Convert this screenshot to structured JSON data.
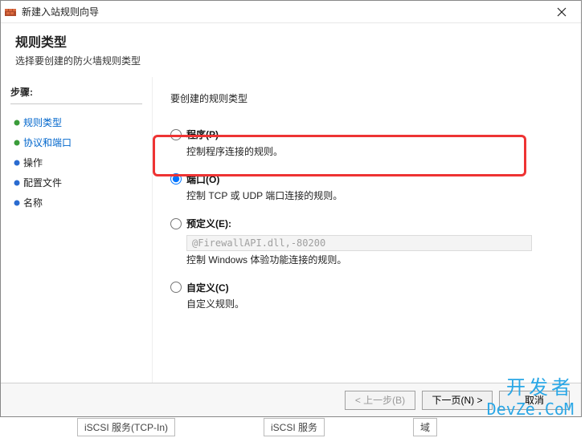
{
  "window": {
    "title": "新建入站规则向导"
  },
  "header": {
    "title": "规则类型",
    "subtitle": "选择要创建的防火墙规则类型"
  },
  "sidebar": {
    "title": "步骤:",
    "items": [
      {
        "label": "规则类型",
        "link": true,
        "bullet": "green"
      },
      {
        "label": "协议和端口",
        "link": true,
        "bullet": "green"
      },
      {
        "label": "操作",
        "link": false,
        "bullet": "blue"
      },
      {
        "label": "配置文件",
        "link": false,
        "bullet": "blue"
      },
      {
        "label": "名称",
        "link": false,
        "bullet": "blue"
      }
    ]
  },
  "main": {
    "prompt": "要创建的规则类型",
    "options": {
      "program": {
        "label": "程序(P)",
        "desc": "控制程序连接的规则。"
      },
      "port": {
        "label": "端口(O)",
        "desc": "控制 TCP 或 UDP 端口连接的规则。"
      },
      "predef": {
        "label": "预定义(E):",
        "select_value": "@FirewallAPI.dll,-80200",
        "desc": "控制 Windows 体验功能连接的规则。"
      },
      "custom": {
        "label": "自定义(C)",
        "desc": "自定义规则。"
      }
    },
    "selected": "port"
  },
  "footer": {
    "back": "< 上一步(B)",
    "next": "下一页(N) >",
    "cancel": "取消"
  },
  "watermark": {
    "l1": "开发者",
    "l2": "DevZe.CoM"
  },
  "below": {
    "cell1": "iSCSI 服务(TCP-In)",
    "cell2": "iSCSI 服务",
    "cell3": "域"
  }
}
